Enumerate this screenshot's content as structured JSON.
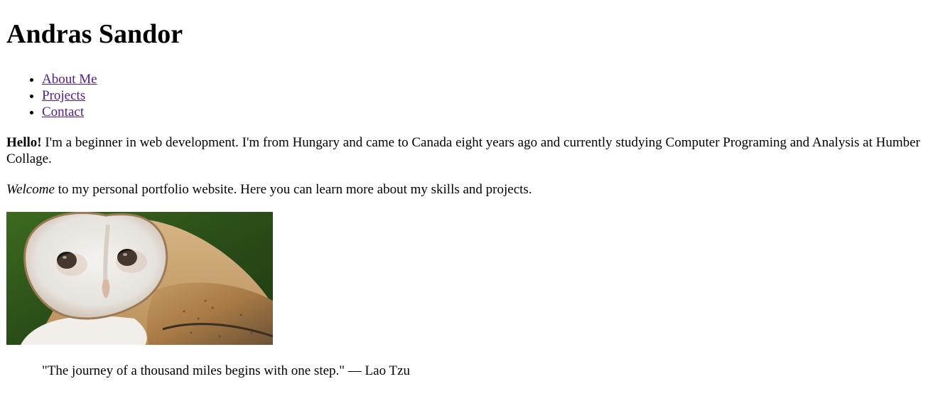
{
  "header": {
    "title": "Andras Sandor"
  },
  "nav": {
    "items": [
      {
        "label": "About Me"
      },
      {
        "label": "Projects"
      },
      {
        "label": "Contact"
      }
    ]
  },
  "intro": {
    "bold_greeting": "Hello!",
    "text": " I'm a beginner in web development. I'm from Hungary and came to Canada eight years ago and currently studying Computer Programing and Analysis at Humber Collage."
  },
  "welcome": {
    "italic_word": "Welcome",
    "text": " to my personal portfolio website. Here you can learn more about my skills and projects."
  },
  "image": {
    "subject": "barn-owl"
  },
  "quote": {
    "text": "\"The journey of a thousand miles begins with one step.\" — Lao Tzu"
  },
  "colors": {
    "link_visited": "#551a8b",
    "text": "#000000",
    "background": "#ffffff"
  }
}
